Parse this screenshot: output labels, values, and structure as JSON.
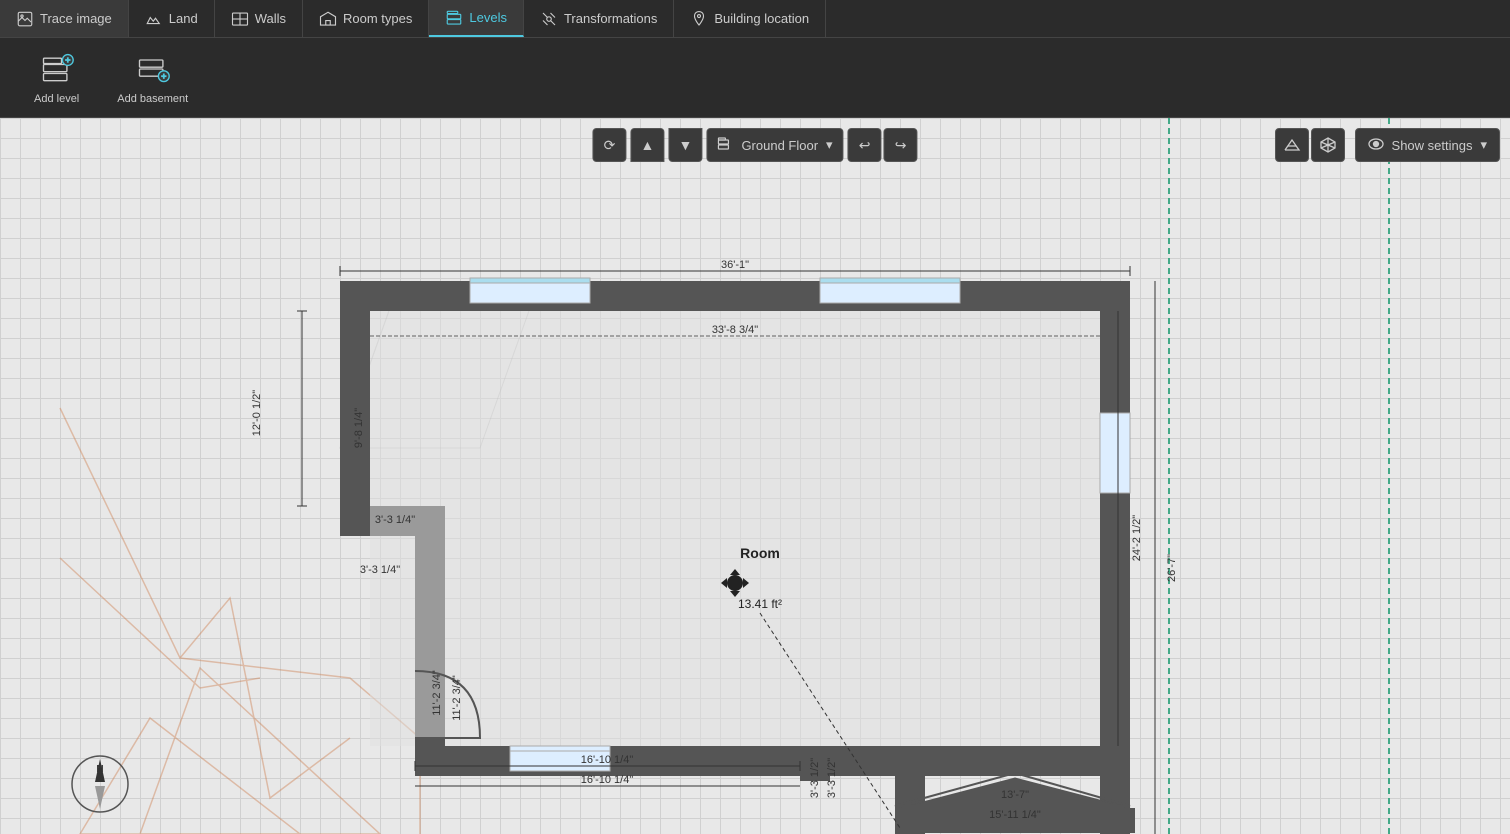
{
  "nav": {
    "items": [
      {
        "id": "trace-image",
        "label": "Trace image",
        "icon": "image-icon",
        "active": false
      },
      {
        "id": "land",
        "label": "Land",
        "icon": "land-icon",
        "active": false
      },
      {
        "id": "walls",
        "label": "Walls",
        "icon": "walls-icon",
        "active": false
      },
      {
        "id": "room-types",
        "label": "Room types",
        "icon": "room-types-icon",
        "active": false
      },
      {
        "id": "levels",
        "label": "Levels",
        "icon": "levels-icon",
        "active": true
      },
      {
        "id": "transformations",
        "label": "Transformations",
        "icon": "transformations-icon",
        "active": false
      },
      {
        "id": "building-location",
        "label": "Building location",
        "icon": "building-location-icon",
        "active": false
      }
    ]
  },
  "secondary_toolbar": {
    "buttons": [
      {
        "id": "add-level",
        "label": "Add level",
        "icon": "add-level-icon"
      },
      {
        "id": "add-basement",
        "label": "Add basement",
        "icon": "add-basement-icon"
      }
    ]
  },
  "canvas_toolbar": {
    "refresh_label": "↺",
    "level_up_label": "▲",
    "level_down_label": "▼",
    "current_level": "Ground Floor",
    "undo_label": "↩",
    "redo_label": "↪",
    "show_settings_label": "Show settings"
  },
  "floor_plan": {
    "dimensions": {
      "top_width": "36'-1\"",
      "inner_top": "33'-8 3/4\"",
      "left_height_top": "12'-0 1/2\"",
      "left_inner_1": "9'-8 1/4\"",
      "step_width_1": "3'-3 1/4\"",
      "step_width_2": "3'-3 1/4\"",
      "bottom_inner_1": "11'-2 3/4\"",
      "bottom_inner_2": "11'-2 3/4\"",
      "bottom_width_1": "16'-10 1/4\"",
      "bottom_width_2": "16'-10 1/4\"",
      "right_height_1": "24'-2 1/2\"",
      "right_height_2": "26'-7\"",
      "bottom_right_1": "3'-3 1/2\"",
      "bottom_right_2": "3'-3 1/2\"",
      "bottom_far_right": "13'-7\"",
      "bottom_far_right_2": "15'-11 1/4\""
    },
    "room": {
      "label": "Room",
      "area": "13.41 ft²"
    }
  }
}
